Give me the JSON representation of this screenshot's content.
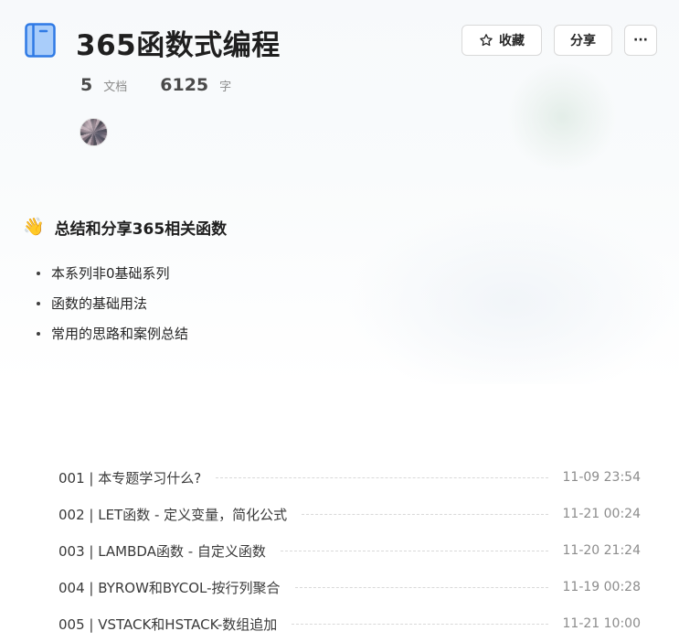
{
  "book": {
    "title": "365函数式编程",
    "icon": "book-icon",
    "accent": "#2f7ae5",
    "stats": {
      "docs_count": "5",
      "docs_unit": "文档",
      "words_count": "6125",
      "words_unit": "字"
    }
  },
  "actions": {
    "favorite_label": "收藏",
    "favorite_icon": "star-icon",
    "share_label": "分享",
    "more_label": "···"
  },
  "intro": {
    "emoji": "👋",
    "heading": "总结和分享365相关函数",
    "bullets": [
      "本系列非0基础系列",
      "函数的基础用法",
      "常用的思路和案例总结"
    ]
  },
  "toc": [
    {
      "title": "001 | 本专题学习什么?",
      "time": "11-09 23:54"
    },
    {
      "title": "002 | LET函数 - 定义变量，简化公式",
      "time": "11-21 00:24"
    },
    {
      "title": "003 | LAMBDA函数 - 自定义函数",
      "time": "11-20 21:24"
    },
    {
      "title": "004 | BYROW和BYCOL-按行列聚合",
      "time": "11-19 00:28"
    },
    {
      "title": "005 | VSTACK和HSTACK-数组追加",
      "time": "11-21 10:00"
    }
  ]
}
